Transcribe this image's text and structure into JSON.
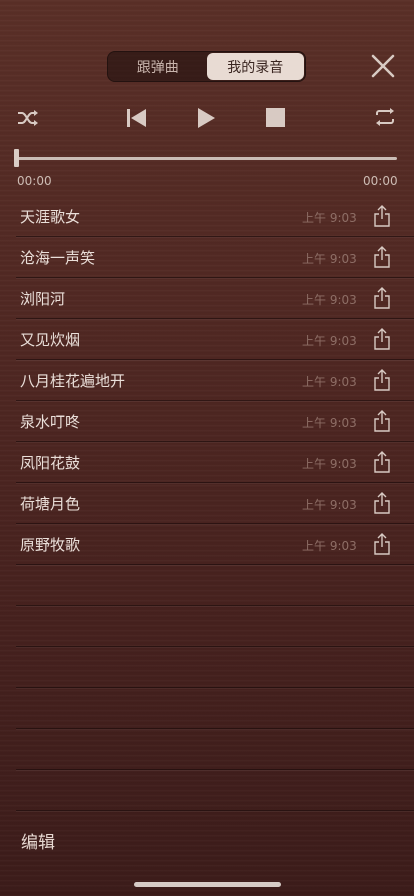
{
  "header": {
    "tabs": [
      {
        "label": "跟弹曲",
        "active": false
      },
      {
        "label": "我的录音",
        "active": true
      }
    ]
  },
  "player": {
    "current_time": "00:00",
    "total_time": "00:00",
    "progress_fraction": 0.0
  },
  "recordings": [
    {
      "title": "天涯歌女",
      "time": "上午 9:03"
    },
    {
      "title": "沧海一声笑",
      "time": "上午 9:03"
    },
    {
      "title": "浏阳河",
      "time": "上午 9:03"
    },
    {
      "title": "又见炊烟",
      "time": "上午 9:03"
    },
    {
      "title": "八月桂花遍地开",
      "time": "上午 9:03"
    },
    {
      "title": "泉水叮咚",
      "time": "上午 9:03"
    },
    {
      "title": "凤阳花鼓",
      "time": "上午 9:03"
    },
    {
      "title": "荷塘月色",
      "time": "上午 9:03"
    },
    {
      "title": "原野牧歌",
      "time": "上午 9:03"
    }
  ],
  "footer": {
    "edit_label": "编辑"
  },
  "icons": {
    "shuffle": "shuffle-icon",
    "previous": "skip-back-icon",
    "play": "play-icon",
    "stop": "stop-icon",
    "repeat": "repeat-icon",
    "close": "close-icon",
    "share": "share-icon"
  },
  "colors": {
    "background": "#4f2722",
    "active_tab": "#e8dbd3",
    "text": "#eadfd9",
    "muted": "#8e6e66"
  }
}
